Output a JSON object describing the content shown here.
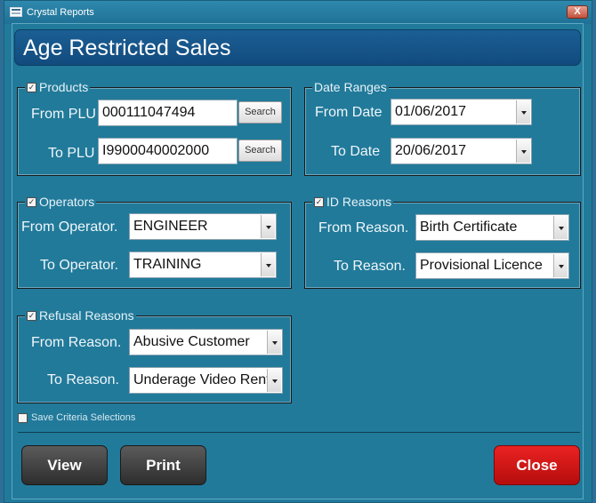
{
  "window": {
    "title": "Crystal Reports",
    "close_glyph": "X"
  },
  "header": {
    "title": "Age Restricted Sales"
  },
  "products": {
    "legend": "Products",
    "checked": true,
    "from_label": "From PLU",
    "from_value": "000111047494",
    "to_label": "To PLU",
    "to_value": "I9900040002000",
    "search_label": "Search"
  },
  "date_ranges": {
    "legend": "Date Ranges",
    "from_label": "From Date",
    "from_value": "01/06/2017",
    "to_label": "To Date",
    "to_value": "20/06/2017"
  },
  "operators": {
    "legend": "Operators",
    "checked": true,
    "from_label": "From Operator.",
    "from_value": "ENGINEER",
    "to_label": "To Operator.",
    "to_value": "TRAINING"
  },
  "id_reasons": {
    "legend": "ID Reasons",
    "checked": true,
    "from_label": "From Reason.",
    "from_value": "Birth Certificate",
    "to_label": "To Reason.",
    "to_value": "Provisional Licence"
  },
  "refusal_reasons": {
    "legend": "Refusal Reasons",
    "checked": true,
    "from_label": "From Reason.",
    "from_value": "Abusive Customer",
    "to_label": "To Reason.",
    "to_value": "Underage Video Rental"
  },
  "save_criteria": {
    "label": "Save Criteria Selections",
    "checked": false
  },
  "buttons": {
    "view": "View",
    "print": "Print",
    "close": "Close"
  },
  "check_glyph": "✓",
  "colors": {
    "background": "#217a9a",
    "header": "#1b5f94",
    "close_button": "#d91616",
    "dark_button": "#3f3f3f"
  }
}
